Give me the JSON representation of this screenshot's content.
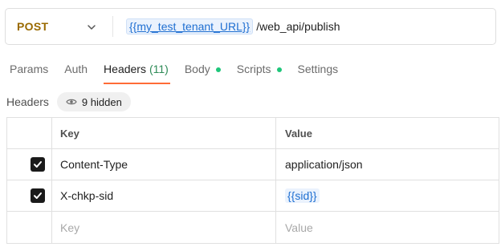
{
  "request": {
    "method": "POST",
    "url_variable": "{{my_test_tenant_URL}}",
    "url_path": "/web_api/publish"
  },
  "tabs": [
    {
      "label": "Params"
    },
    {
      "label": "Auth"
    },
    {
      "label": "Headers",
      "count": "(11)"
    },
    {
      "label": "Body"
    },
    {
      "label": "Scripts"
    },
    {
      "label": "Settings"
    }
  ],
  "headers_section": {
    "title": "Headers",
    "hidden_label": "9 hidden"
  },
  "table": {
    "columns": {
      "key": "Key",
      "value": "Value"
    },
    "rows": [
      {
        "checked": true,
        "key": "Content-Type",
        "value": "application/json"
      },
      {
        "checked": true,
        "key": "X-chkp-sid",
        "value": "{{sid}}"
      }
    ],
    "placeholder": {
      "key": "Key",
      "value": "Value"
    }
  },
  "colors": {
    "method": "#9a6a00",
    "active_tab_underline": "#ff6c37",
    "status_dot": "#1ec67a",
    "variable": "#1f6fd1",
    "tab_count": "#2e8b57"
  },
  "icons": {
    "method_dropdown": "chevron-down-icon",
    "hidden_toggle": "eye-icon",
    "checkbox": "checkmark-icon"
  }
}
